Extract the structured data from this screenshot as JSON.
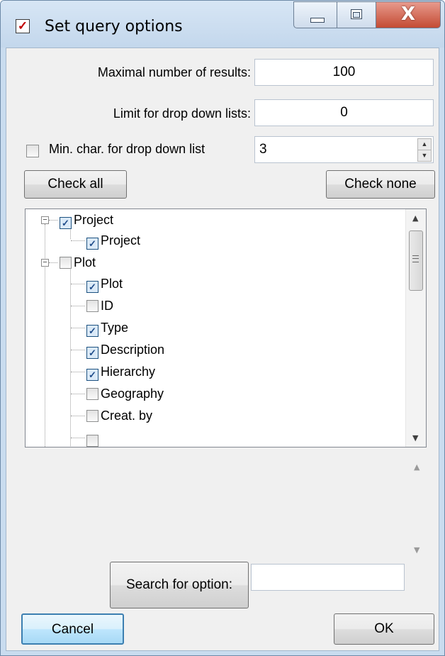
{
  "window": {
    "title": "Set query options",
    "title_icon": "checkbox-icon"
  },
  "title_buttons": {
    "minimize_icon": "minimize-icon",
    "maximize_icon": "maximize-icon",
    "close_icon": "close-icon",
    "close_glyph": "X"
  },
  "fields": {
    "max_results_label": "Maximal number of results:",
    "max_results_value": "100",
    "dropdown_limit_label": "Limit for drop down lists:",
    "dropdown_limit_value": "0",
    "min_char_label": "Min. char. for drop down list",
    "min_char_checked": false,
    "min_char_value": "3"
  },
  "buttons": {
    "check_all": "Check all",
    "check_none": "Check none",
    "search_option": "Search for option:",
    "cancel": "Cancel",
    "ok": "OK"
  },
  "search": {
    "value": ""
  },
  "tree": {
    "items": [
      {
        "label": "Project",
        "checked": true,
        "level": 0,
        "expandable": true
      },
      {
        "label": "Project",
        "checked": true,
        "level": 1
      },
      {
        "label": "Plot",
        "checked": false,
        "level": 0,
        "expandable": true
      },
      {
        "label": "Plot",
        "checked": true,
        "level": 1
      },
      {
        "label": "ID",
        "checked": false,
        "level": 1
      },
      {
        "label": "Type",
        "checked": true,
        "level": 1
      },
      {
        "label": "Description",
        "checked": true,
        "level": 1
      },
      {
        "label": "Hierarchy",
        "checked": true,
        "level": 1
      },
      {
        "label": "Geography",
        "checked": false,
        "level": 1
      },
      {
        "label": "Creat. by",
        "checked": false,
        "level": 1
      }
    ]
  },
  "colors": {
    "title_bar": "#c9dcef",
    "close_button": "#c44b33",
    "check_mark": "#1f4c8a"
  }
}
